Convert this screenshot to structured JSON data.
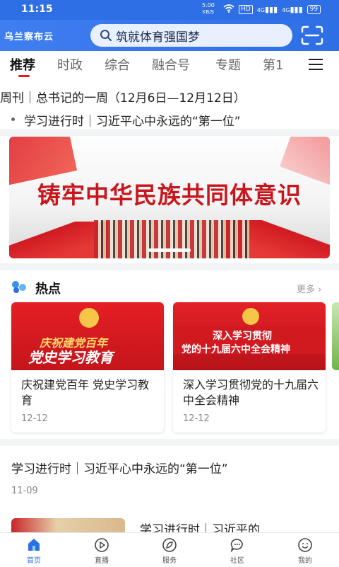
{
  "status_bar": {
    "time": "11:15",
    "net_speed_value": "5.00",
    "net_speed_unit": "KB/S",
    "hd_label": "HD",
    "signal_1": "4G",
    "signal_2": "4G",
    "battery": "99"
  },
  "app_bar": {
    "logo_text": "乌兰察布云",
    "search_text": "筑就体育强国梦",
    "accent_color": "#2f6fe6"
  },
  "tabs": {
    "items": [
      {
        "label": "推荐",
        "active": true
      },
      {
        "label": "时政",
        "active": false
      },
      {
        "label": "综合",
        "active": false
      },
      {
        "label": "融合号",
        "active": false
      },
      {
        "label": "专题",
        "active": false
      },
      {
        "label": "第1",
        "active": false
      }
    ]
  },
  "headlines": [
    "周刊｜总书记的一周（12月6日—12月12日）",
    "学习进行时｜习近平心中永远的“第一位”"
  ],
  "banner": {
    "title": "铸牢中华民族共同体意识"
  },
  "hot": {
    "title": "热点",
    "more_label": "更多",
    "cards": [
      {
        "image_line1": "庆祝建党百年",
        "image_line2": "党史学习教育",
        "title": "庆祝建党百年 党史学习教育",
        "date": "12-12"
      },
      {
        "image_line1": "深入学习贯彻",
        "image_line2": "党的十九届六中全会精神",
        "title": "深入学习贯彻党的十九届六中全会精神",
        "date": "12-12"
      }
    ]
  },
  "article": {
    "title": "学习进行时｜习近平心中永远的“第一位”",
    "date": "11-09"
  },
  "article2": {
    "title": "学习进行时｜习近平的"
  },
  "bottom_nav": [
    {
      "label": "首页",
      "icon": "home-icon",
      "active": true
    },
    {
      "label": "直播",
      "icon": "live-icon",
      "active": false
    },
    {
      "label": "服务",
      "icon": "service-icon",
      "active": false
    },
    {
      "label": "社区",
      "icon": "community-icon",
      "active": false
    },
    {
      "label": "我的",
      "icon": "profile-icon",
      "active": false
    }
  ]
}
